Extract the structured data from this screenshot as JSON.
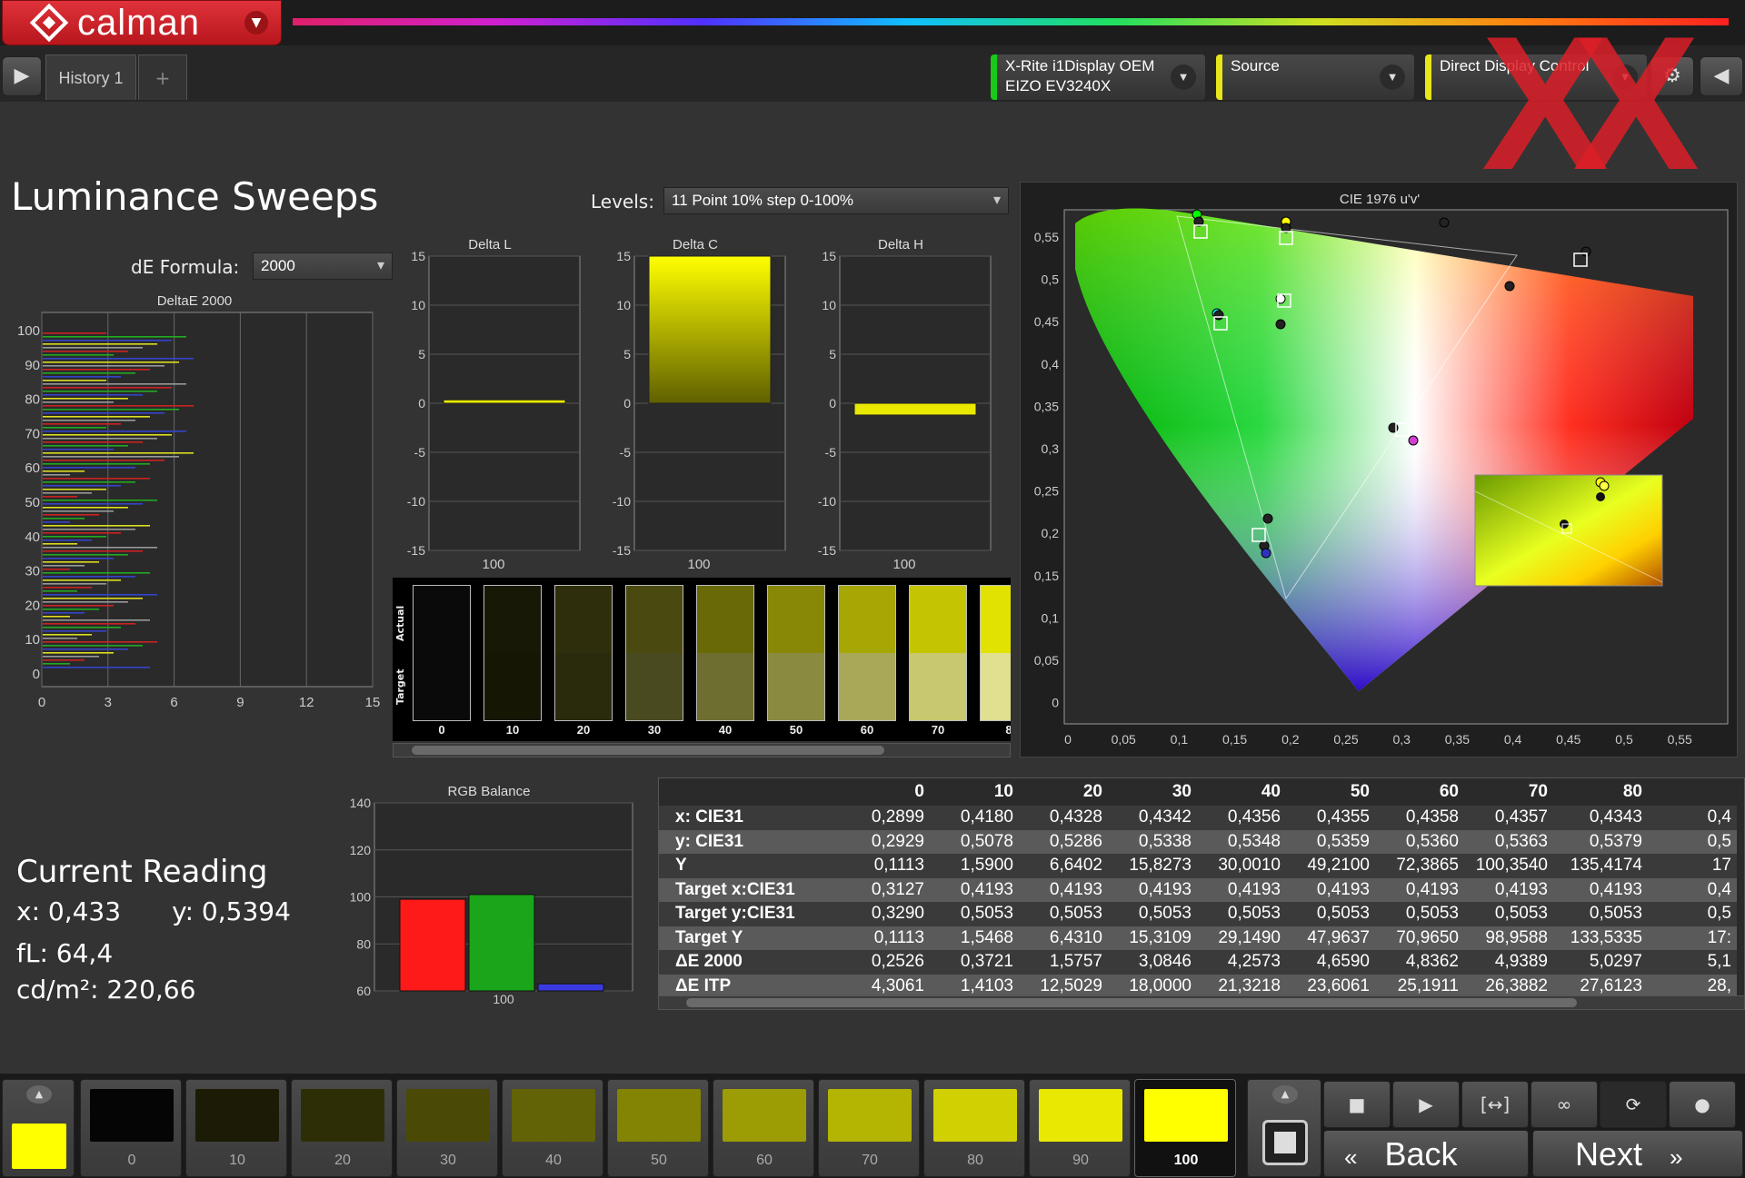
{
  "app": {
    "name": "calman",
    "history_tab": "History 1",
    "tab_add": "+"
  },
  "devices": [
    {
      "line1": "X-Rite i1Display OEM",
      "line2": "EIZO EV3240X",
      "color": "#19c919"
    },
    {
      "line1": "Source",
      "line2": "",
      "color": "#e6e61a"
    },
    {
      "line1": "Direct Display Control",
      "line2": "",
      "color": "#e6e61a"
    }
  ],
  "page": {
    "title": "Luminance Sweeps",
    "levels_label": "Levels:",
    "levels_value": "11 Point 10% step 0-100%",
    "de_label": "dE Formula:",
    "de_value": "2000"
  },
  "deltae_chart": {
    "title": "DeltaE 2000",
    "yticks": [
      "100",
      "90",
      "80",
      "70",
      "60",
      "50",
      "40",
      "30",
      "20",
      "10",
      "0"
    ],
    "xticks": [
      "0",
      "3",
      "6",
      "9",
      "12",
      "15"
    ]
  },
  "delta_charts": [
    {
      "title": "Delta L",
      "value": 0.35,
      "xlabel": "100"
    },
    {
      "title": "Delta C",
      "value": 15.0,
      "xlabel": "100"
    },
    {
      "title": "Delta H",
      "value": -1.2,
      "xlabel": "100"
    }
  ],
  "delta_yticks": [
    "15",
    "10",
    "5",
    "0",
    "-5",
    "-10",
    "-15"
  ],
  "swatch_strip": {
    "actual_label": "Actual",
    "target_label": "Target",
    "items": [
      {
        "label": "0",
        "actual": "#0a0a0a",
        "target": "#0a0a0a"
      },
      {
        "label": "10",
        "actual": "#181806",
        "target": "#161605"
      },
      {
        "label": "20",
        "actual": "#2e2e0c",
        "target": "#2a2a0c"
      },
      {
        "label": "30",
        "actual": "#4a4a10",
        "target": "#4a4a20"
      },
      {
        "label": "40",
        "actual": "#696908",
        "target": "#6e6e30"
      },
      {
        "label": "50",
        "actual": "#888806",
        "target": "#8a8a40"
      },
      {
        "label": "60",
        "actual": "#a6a604",
        "target": "#a8a858"
      },
      {
        "label": "70",
        "actual": "#c4c402",
        "target": "#c8c870"
      },
      {
        "label": "8",
        "actual": "#e2e200",
        "target": "#e0e090"
      }
    ]
  },
  "cie": {
    "title": "CIE 1976 u'v'",
    "xticks": [
      "0",
      "0,05",
      "0,1",
      "0,15",
      "0,2",
      "0,25",
      "0,3",
      "0,35",
      "0,4",
      "0,45",
      "0,5",
      "0,55"
    ],
    "yticks": [
      "0,55",
      "0,5",
      "0,45",
      "0,4",
      "0,35",
      "0,3",
      "0,25",
      "0,2",
      "0,15",
      "0,1",
      "0,05",
      "0"
    ]
  },
  "rgb_balance": {
    "title": "RGB Balance",
    "yticks": [
      "140",
      "120",
      "100",
      "80",
      "60"
    ],
    "xlabel": "100",
    "values": [
      99,
      101,
      63
    ],
    "colors": [
      "#ff1a1a",
      "#1aa51a",
      "#3a3ae0"
    ]
  },
  "current_reading": {
    "heading": "Current Reading",
    "x": "x: 0,433",
    "y": "y: 0,5394",
    "fl": "fL: 64,4",
    "cdm": "cd/m²: 220,66"
  },
  "table": {
    "columns": [
      "0",
      "10",
      "20",
      "30",
      "40",
      "50",
      "60",
      "70",
      "80",
      ""
    ],
    "rows": [
      {
        "label": "x: CIE31",
        "values": [
          "0,2899",
          "0,4180",
          "0,4328",
          "0,4342",
          "0,4356",
          "0,4355",
          "0,4358",
          "0,4357",
          "0,4343",
          "0,4"
        ]
      },
      {
        "label": "y: CIE31",
        "values": [
          "0,2929",
          "0,5078",
          "0,5286",
          "0,5338",
          "0,5348",
          "0,5359",
          "0,5360",
          "0,5363",
          "0,5379",
          "0,5"
        ]
      },
      {
        "label": "Y",
        "values": [
          "0,1113",
          "1,5900",
          "6,6402",
          "15,8273",
          "30,0010",
          "49,2100",
          "72,3865",
          "100,3540",
          "135,4174",
          "17"
        ]
      },
      {
        "label": "Target x:CIE31",
        "values": [
          "0,3127",
          "0,4193",
          "0,4193",
          "0,4193",
          "0,4193",
          "0,4193",
          "0,4193",
          "0,4193",
          "0,4193",
          "0,4"
        ]
      },
      {
        "label": "Target y:CIE31",
        "values": [
          "0,3290",
          "0,5053",
          "0,5053",
          "0,5053",
          "0,5053",
          "0,5053",
          "0,5053",
          "0,5053",
          "0,5053",
          "0,5"
        ]
      },
      {
        "label": "Target Y",
        "values": [
          "0,1113",
          "1,5468",
          "6,4310",
          "15,3109",
          "29,1490",
          "47,9637",
          "70,9650",
          "98,9588",
          "133,5335",
          "17:"
        ]
      },
      {
        "label": "ΔE 2000",
        "values": [
          "0,2526",
          "0,3721",
          "1,5757",
          "3,0846",
          "4,2573",
          "4,6590",
          "4,8362",
          "4,9389",
          "5,0297",
          "5,1"
        ]
      },
      {
        "label": "ΔE ITP",
        "values": [
          "4,3061",
          "1,4103",
          "12,5029",
          "18,0000",
          "21,3218",
          "23,6061",
          "25,1911",
          "26,3882",
          "27,6123",
          "28,"
        ]
      }
    ]
  },
  "bottom_swatches": [
    {
      "label": "0",
      "color": "#050505"
    },
    {
      "label": "10",
      "color": "#1c1c06"
    },
    {
      "label": "20",
      "color": "#2e2e06"
    },
    {
      "label": "30",
      "color": "#4a4a06"
    },
    {
      "label": "40",
      "color": "#626206"
    },
    {
      "label": "50",
      "color": "#838304"
    },
    {
      "label": "60",
      "color": "#9c9c04"
    },
    {
      "label": "70",
      "color": "#b4b402"
    },
    {
      "label": "80",
      "color": "#d0d002"
    },
    {
      "label": "90",
      "color": "#e8e802"
    },
    {
      "label": "100",
      "color": "#ffff00"
    }
  ],
  "current_color": "#ffff00",
  "nav": {
    "back": "Back",
    "next": "Next"
  }
}
